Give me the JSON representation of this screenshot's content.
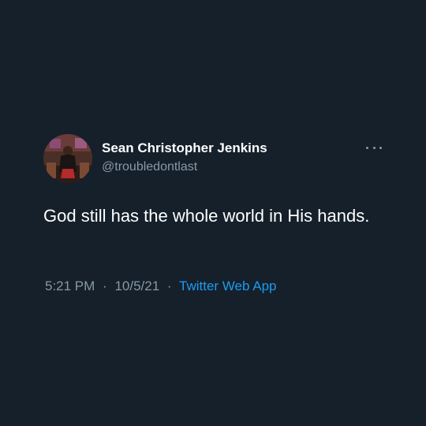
{
  "tweet": {
    "display_name": "Sean Christopher Jenkins",
    "handle": "@troubledontlast",
    "text": "God still has the whole world in His hands.",
    "time": "5:21 PM",
    "date": "10/5/21",
    "separator": "·",
    "source": "Twitter Web App"
  },
  "icons": {
    "more": "more-horizontal-icon",
    "avatar": "profile-photo"
  },
  "colors": {
    "background": "#15202b",
    "primary_text": "#ffffff",
    "secondary_text": "#8899a6",
    "link": "#1d9bf0"
  }
}
